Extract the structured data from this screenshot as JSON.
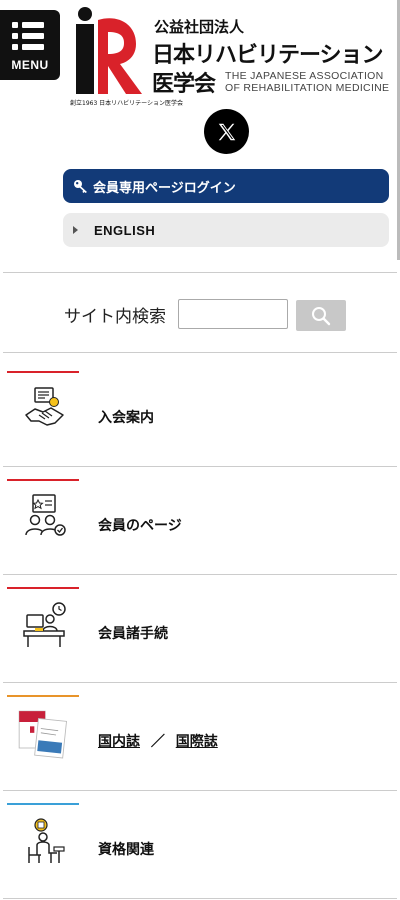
{
  "menu": {
    "label": "MENU"
  },
  "logo": {
    "founded": "創立1963 日本リハビリテーション医学会",
    "org_type": "公益社団法人",
    "name_line1": "日本リハビリテーション",
    "name_line2": "医学会",
    "english_line1": "THE JAPANESE ASSOCIATION",
    "english_line2": "OF REHABILITATION MEDICINE",
    "brand_red": "#d9222a"
  },
  "social": {
    "x_icon": "x-logo-icon"
  },
  "buttons": {
    "login_label": "会員専用ページログイン",
    "english_label": "ENGLISH",
    "login_color": "#123a78"
  },
  "search": {
    "label": "サイト内検索",
    "value": "",
    "placeholder": "",
    "icon": "search-icon"
  },
  "nav": {
    "items": [
      {
        "label": "入会案内",
        "accent": "#d9222a",
        "icon": "handshake-icon"
      },
      {
        "label": "会員のページ",
        "accent": "#d9222a",
        "icon": "members-icon"
      },
      {
        "label": "会員諸手続",
        "accent": "#d9222a",
        "icon": "office-desk-icon"
      },
      {
        "label_a": "国内誌",
        "separator": "／",
        "label_b": "国際誌",
        "accent": "#e8942a",
        "icon": "journals-icon"
      },
      {
        "label": "資格関連",
        "accent": "#3aa0d8",
        "icon": "qualification-icon"
      }
    ]
  }
}
